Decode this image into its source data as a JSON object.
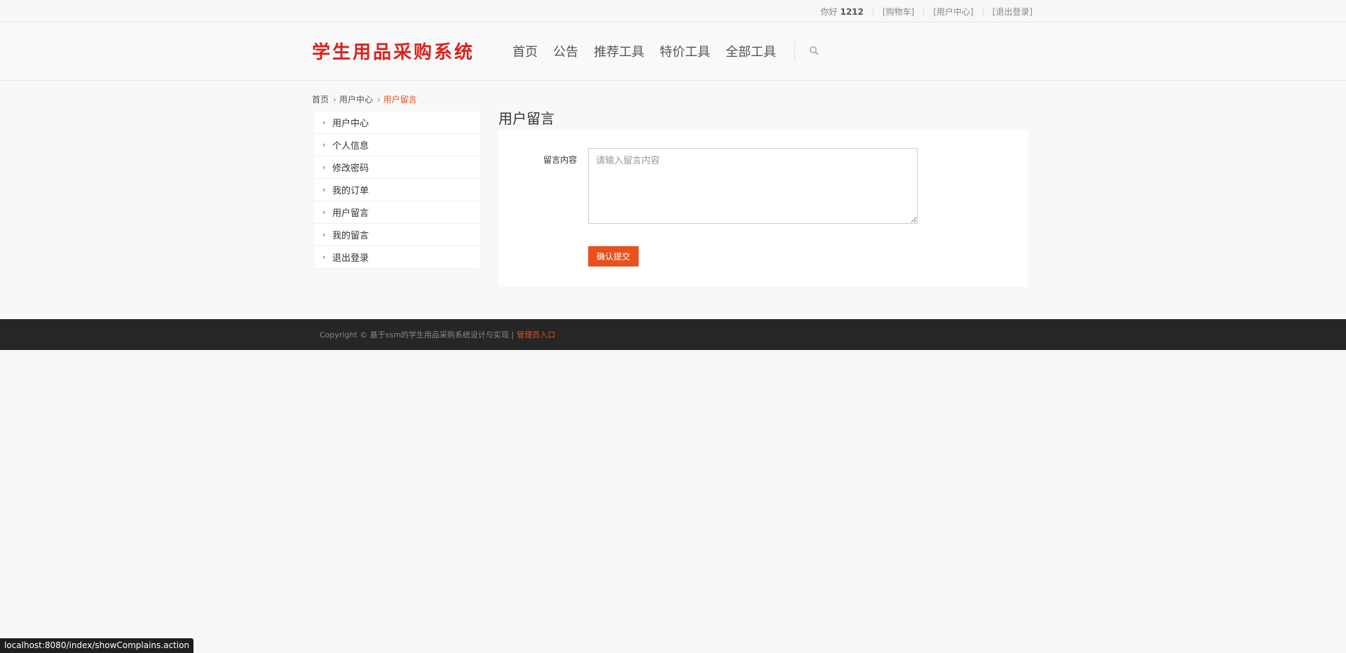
{
  "topbar": {
    "greet_prefix": "你好",
    "username": "1212",
    "cart": "[购物车]",
    "user_center": "[用户中心]",
    "logout": "[退出登录]"
  },
  "header": {
    "logo": "学生用品采购系统",
    "nav": [
      "首页",
      "公告",
      "推荐工具",
      "特价工具",
      "全部工具"
    ]
  },
  "breadcrumb": {
    "home": "首页",
    "parent": "用户中心",
    "current": "用户留言"
  },
  "sidebar": {
    "items": [
      "用户中心",
      "个人信息",
      "修改密码",
      "我的订单",
      "用户留言",
      "我的留言",
      "退出登录"
    ]
  },
  "main": {
    "title": "用户留言",
    "label": "留言内容",
    "placeholder": "请输入留言内容",
    "value": "",
    "submit": "确认提交"
  },
  "footer": {
    "copyright": "Copyright © 基于ssm的学生用品采购系统设计与实现 |",
    "admin": "管理员入口"
  },
  "statusbar": {
    "url": "localhost:8080/index/showComplains.action"
  },
  "colors": {
    "accent": "#e8501d",
    "logo": "#d8221d",
    "footer_bg": "#262626"
  }
}
